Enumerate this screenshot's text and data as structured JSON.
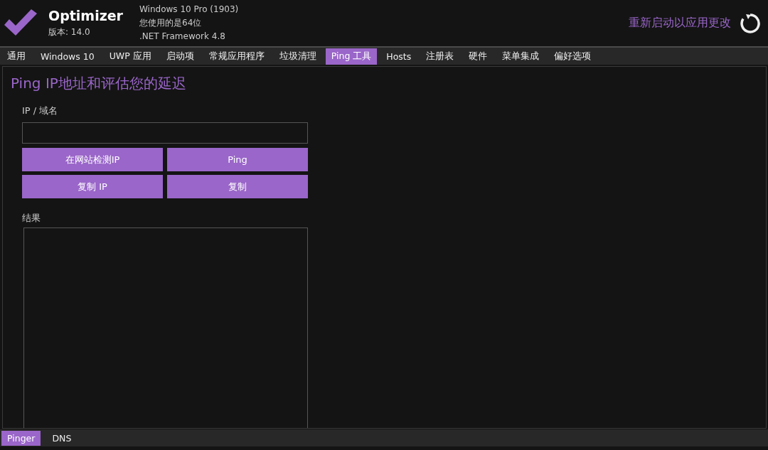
{
  "app": {
    "name": "Optimizer",
    "version": "版本: 14.0",
    "system_info": [
      "Windows 10 Pro (1903)",
      "您使用的是64位",
      ".NET Framework 4.8"
    ],
    "restart_label": "重新启动以应用更改"
  },
  "tabs": [
    {
      "label": "通用",
      "selected": false
    },
    {
      "label": "Windows 10",
      "selected": false
    },
    {
      "label": "UWP 应用",
      "selected": false
    },
    {
      "label": "启动项",
      "selected": false
    },
    {
      "label": "常规应用程序",
      "selected": false
    },
    {
      "label": "垃圾清理",
      "selected": false
    },
    {
      "label": "Ping 工具",
      "selected": true
    },
    {
      "label": "Hosts",
      "selected": false
    },
    {
      "label": "注册表",
      "selected": false
    },
    {
      "label": "硬件",
      "selected": false
    },
    {
      "label": "菜单集成",
      "selected": false
    },
    {
      "label": "偏好选项",
      "selected": false
    }
  ],
  "panel": {
    "title": "Ping IP地址和评估您的延迟",
    "field_label": "IP / 域名",
    "buttons": [
      "在网站检测IP",
      "Ping",
      "复制 IP",
      "复制"
    ],
    "results_label": "结果"
  },
  "sub_tabs": [
    {
      "label": "Pinger",
      "selected": true
    },
    {
      "label": "DNS",
      "selected": false
    }
  ]
}
